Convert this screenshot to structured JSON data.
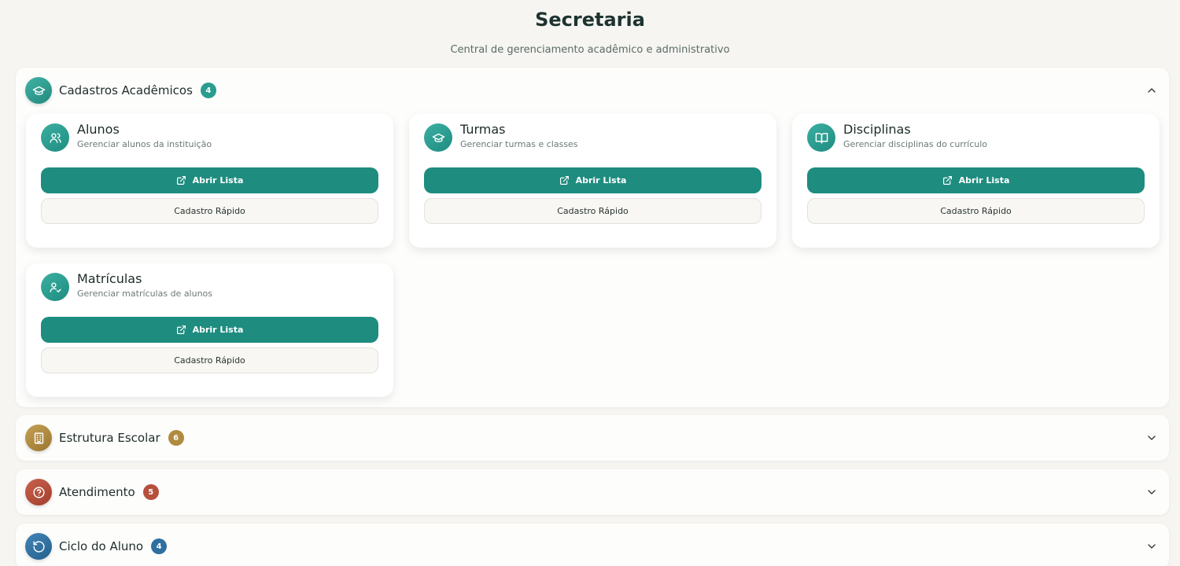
{
  "page": {
    "title": "Secretaria",
    "subtitle": "Central de gerenciamento acadêmico e administrativo"
  },
  "sections": [
    {
      "title": "Cadastros Acadêmicos",
      "count": "4",
      "color": "#2a9d8f",
      "icon": "graduation-cap-icon",
      "expanded": true,
      "cards": [
        {
          "title": "Alunos",
          "description": "Gerenciar alunos da instituição",
          "icon": "users-icon",
          "primary_label": "Abrir Lista",
          "secondary_label": "Cadastro Rápido"
        },
        {
          "title": "Turmas",
          "description": "Gerenciar turmas e classes",
          "icon": "graduation-cap-icon",
          "primary_label": "Abrir Lista",
          "secondary_label": "Cadastro Rápido"
        },
        {
          "title": "Disciplinas",
          "description": "Gerenciar disciplinas do currículo",
          "icon": "book-open-icon",
          "primary_label": "Abrir Lista",
          "secondary_label": "Cadastro Rápido"
        },
        {
          "title": "Matrículas",
          "description": "Gerenciar matrículas de alunos",
          "icon": "user-check-icon",
          "primary_label": "Abrir Lista",
          "secondary_label": "Cadastro Rápido"
        }
      ]
    },
    {
      "title": "Estrutura Escolar",
      "count": "6",
      "color": "#b08a3e",
      "icon": "building-icon",
      "expanded": false
    },
    {
      "title": "Atendimento",
      "count": "5",
      "color": "#b5503d",
      "icon": "help-circle-icon",
      "expanded": false
    },
    {
      "title": "Ciclo do Aluno",
      "count": "4",
      "color": "#2f6f9f",
      "icon": "rotate-icon",
      "expanded": false
    }
  ]
}
